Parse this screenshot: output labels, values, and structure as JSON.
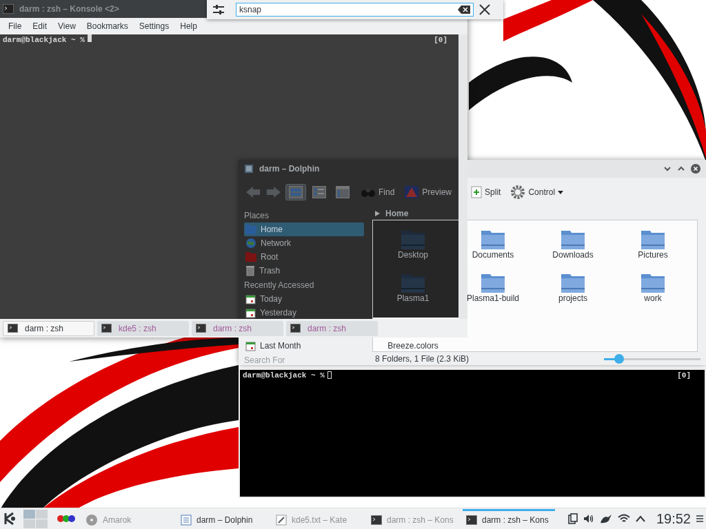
{
  "krunner": {
    "query": "ksnap"
  },
  "konsole": {
    "title": "darm : zsh – Konsole <2>",
    "menu": [
      "File",
      "Edit",
      "View",
      "Bookmarks",
      "Settings",
      "Help"
    ],
    "prompt": "darm@blackjack ~ %",
    "indicator": "[0]",
    "tabs": [
      {
        "label": "darm : zsh",
        "selected": true
      },
      {
        "label": "kde5 : zsh",
        "selected": false
      },
      {
        "label": "darm : zsh",
        "selected": false
      },
      {
        "label": "darm : zsh",
        "selected": false
      }
    ]
  },
  "dolphin": {
    "title": "darm – Dolphin",
    "toolbar": [
      {
        "kind": "back"
      },
      {
        "kind": "forward"
      },
      {
        "kind": "view-icons",
        "selected": true
      },
      {
        "kind": "view-details",
        "selected": false
      },
      {
        "kind": "view-compact",
        "selected": false
      },
      {
        "kind": "find",
        "label": "Find"
      },
      {
        "kind": "preview",
        "label": "Preview"
      },
      {
        "kind": "split",
        "label": "Split"
      },
      {
        "kind": "control",
        "label": "Control"
      }
    ],
    "places_heading": "Places",
    "places": [
      {
        "kind": "home",
        "label": "Home",
        "selected": true
      },
      {
        "kind": "network",
        "label": "Network",
        "selected": false
      },
      {
        "kind": "root",
        "label": "Root",
        "selected": false
      },
      {
        "kind": "trash",
        "label": "Trash",
        "selected": false
      }
    ],
    "recent_heading": "Recently Accessed",
    "recent": [
      {
        "label": "Today"
      },
      {
        "label": "Yesterday"
      },
      {
        "label": "Last Month"
      }
    ],
    "search_heading": "Search For",
    "breadcrumb": "Home",
    "files": [
      {
        "kind": "folder",
        "name": "Desktop"
      },
      {
        "kind": "folder",
        "name": "Documents"
      },
      {
        "kind": "folder",
        "name": "Downloads"
      },
      {
        "kind": "folder",
        "name": "Pictures"
      },
      {
        "kind": "folder",
        "name": "Plasma1"
      },
      {
        "kind": "folder",
        "name": "Plasma1-build"
      },
      {
        "kind": "folder",
        "name": "projects"
      },
      {
        "kind": "folder",
        "name": "work"
      },
      {
        "kind": "file",
        "name": "Breeze.colors"
      }
    ],
    "status": "8 Folders, 1 File (2.3 KiB)",
    "zoom": {
      "level": 0.16
    }
  },
  "yakuake": {
    "prompt": "darm@blackjack ~ %",
    "indicator": "[0]"
  },
  "taskbar": {
    "pager": [
      {
        "selected": true
      },
      {
        "selected": false
      },
      {
        "selected": false
      },
      {
        "selected": false
      }
    ],
    "tasks": [
      {
        "kind": "amarok",
        "label": "Amarok",
        "selected": false,
        "dimmed": true
      },
      {
        "kind": "dolphin",
        "label": "darm – Dolphin",
        "selected": false,
        "dimmed": false
      },
      {
        "kind": "kate",
        "label": "kde5.txt – Kate",
        "selected": false,
        "dimmed": true
      },
      {
        "kind": "konsole",
        "label": "darm : zsh – Kons",
        "selected": false,
        "dimmed": true
      },
      {
        "kind": "konsole",
        "label": "darm : zsh – Kons",
        "selected": true,
        "dimmed": false
      }
    ],
    "clock": "19:52"
  }
}
